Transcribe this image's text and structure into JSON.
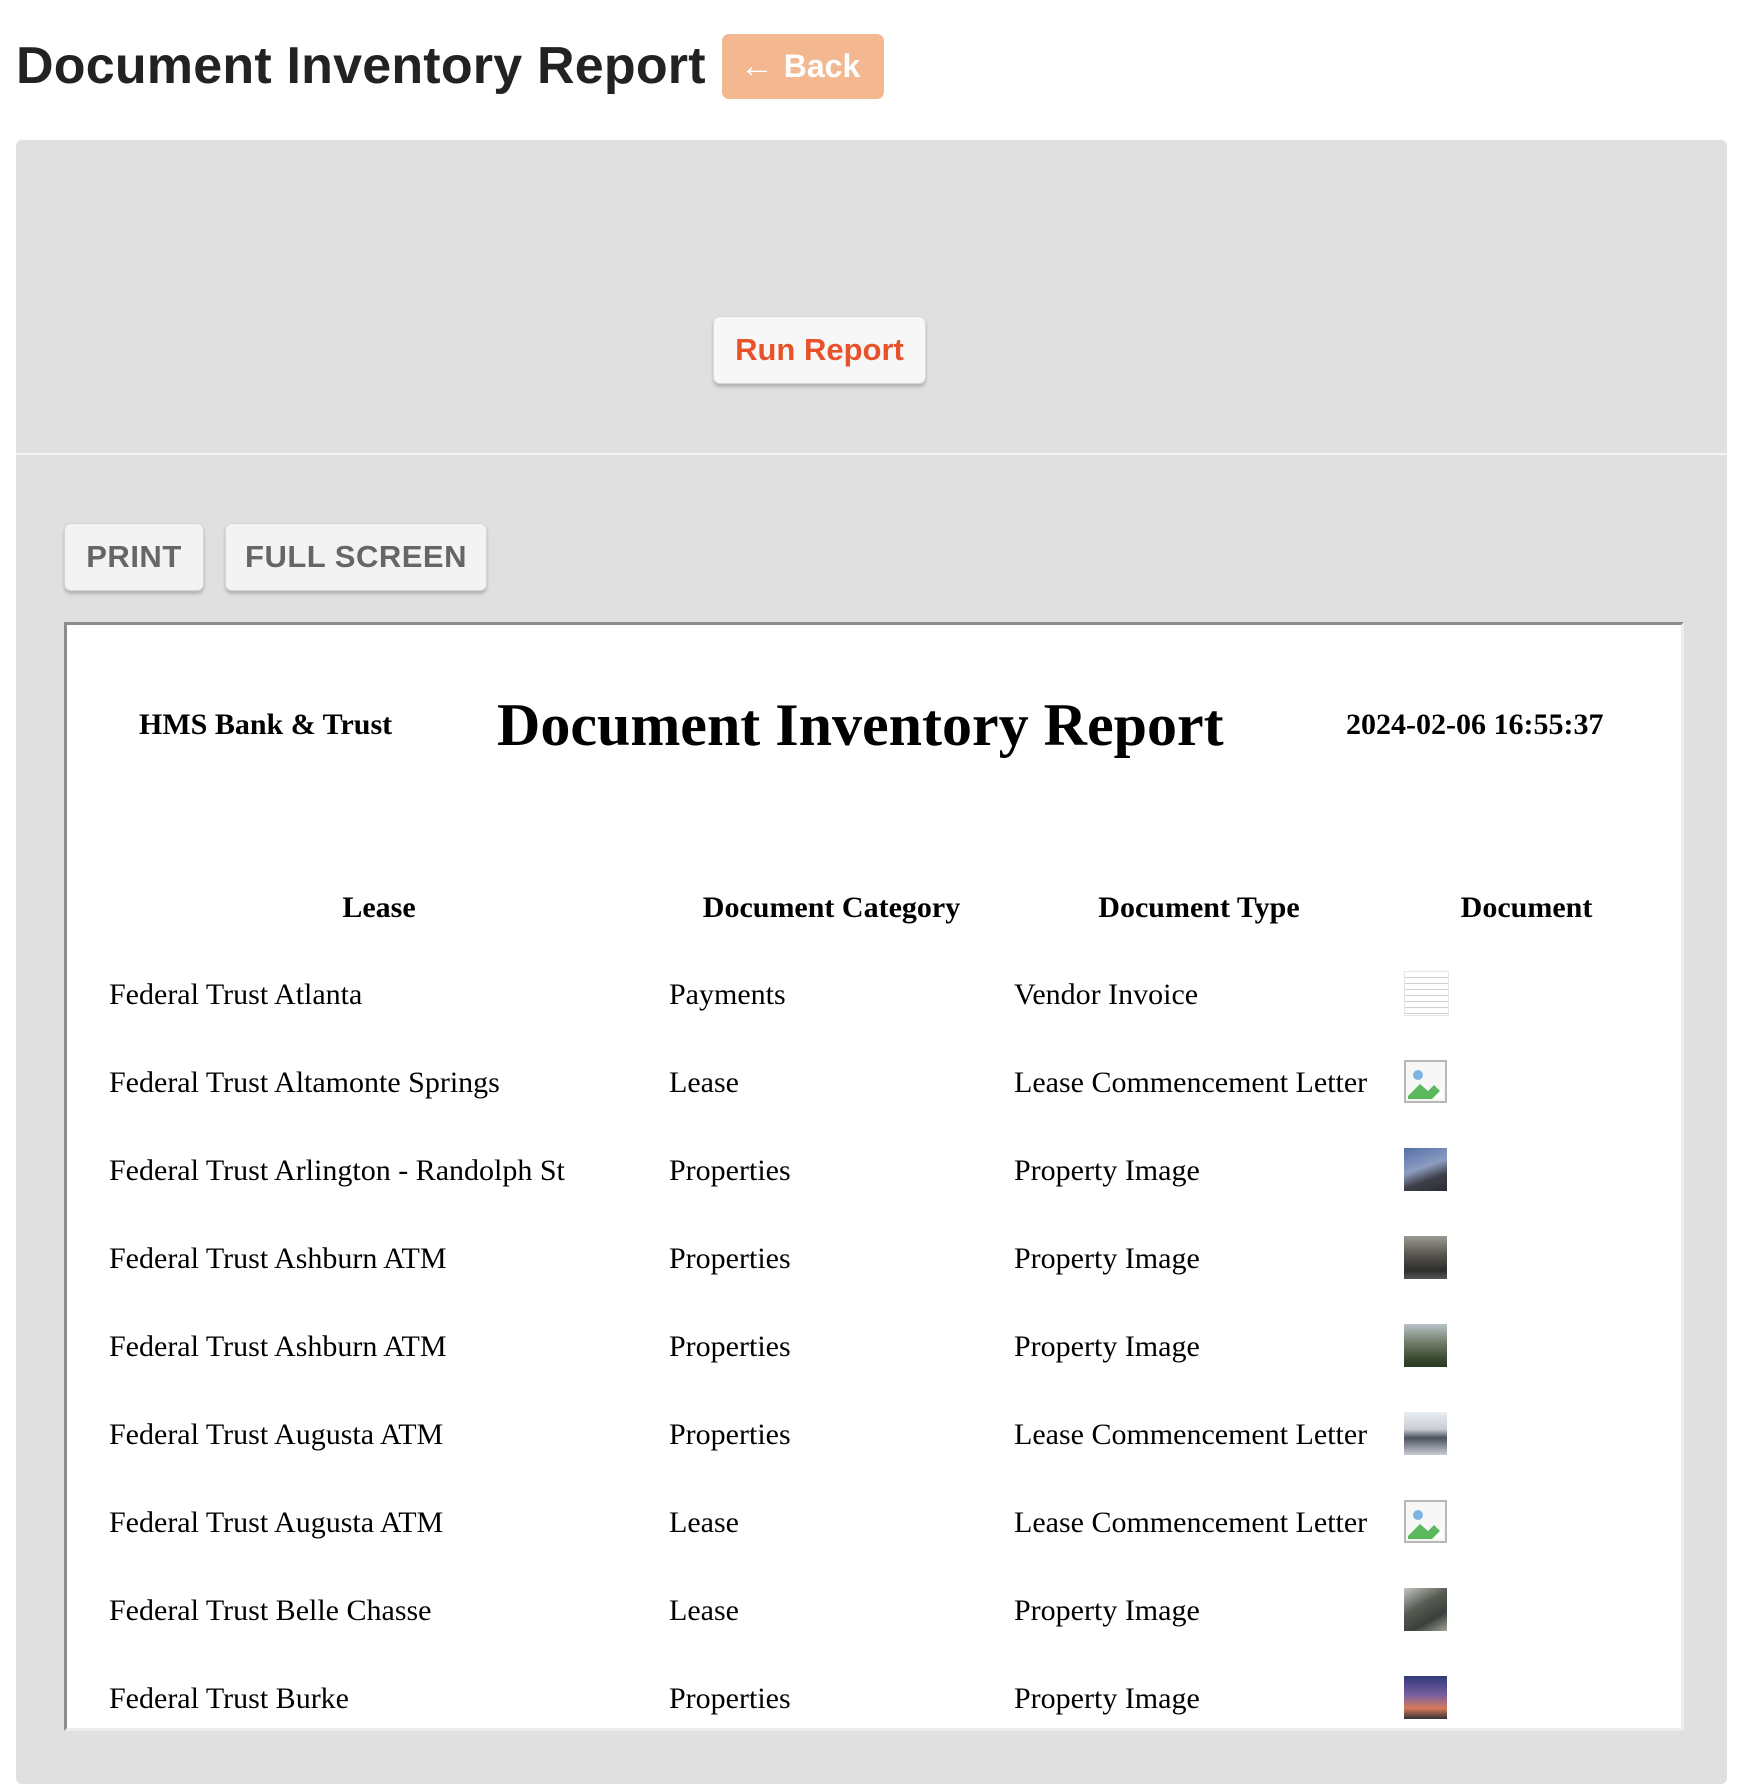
{
  "header": {
    "title": "Document Inventory Report",
    "back_label": "Back",
    "back_icon": "←"
  },
  "controls": {
    "run_report_label": "Run Report",
    "print_label": "PRINT",
    "full_screen_label": "FULL SCREEN"
  },
  "report": {
    "company": "HMS Bank & Trust",
    "title": "Document Inventory Report",
    "generated_at": "2024-02-06 16:55:37",
    "columns": [
      "Lease",
      "Document Category",
      "Document Type",
      "Document"
    ],
    "rows": [
      {
        "lease": "Federal Trust Atlanta",
        "category": "Payments",
        "type": "Vendor Invoice",
        "thumb": "document-thumbnail"
      },
      {
        "lease": "Federal Trust Altamonte Springs",
        "category": "Lease",
        "type": "Lease Commencement Letter",
        "thumb": "broken-image"
      },
      {
        "lease": "Federal Trust Arlington - Randolph St",
        "category": "Properties",
        "type": "Property Image",
        "thumb": "photo-thumbnail"
      },
      {
        "lease": "Federal Trust Ashburn ATM",
        "category": "Properties",
        "type": "Property Image",
        "thumb": "photo-thumbnail"
      },
      {
        "lease": "Federal Trust Ashburn ATM",
        "category": "Properties",
        "type": "Property Image",
        "thumb": "photo-thumbnail"
      },
      {
        "lease": "Federal Trust Augusta ATM",
        "category": "Properties",
        "type": "Lease Commencement Letter",
        "thumb": "photo-thumbnail"
      },
      {
        "lease": "Federal Trust Augusta ATM",
        "category": "Lease",
        "type": "Lease Commencement Letter",
        "thumb": "broken-image"
      },
      {
        "lease": "Federal Trust Belle Chasse",
        "category": "Lease",
        "type": "Property Image",
        "thumb": "photo-thumbnail"
      },
      {
        "lease": "Federal Trust Burke",
        "category": "Properties",
        "type": "Property Image",
        "thumb": "photo-thumbnail"
      }
    ]
  },
  "colors": {
    "accent": "#e8522a",
    "back_button": "#f3b890",
    "panel": "#e0e0e0"
  }
}
